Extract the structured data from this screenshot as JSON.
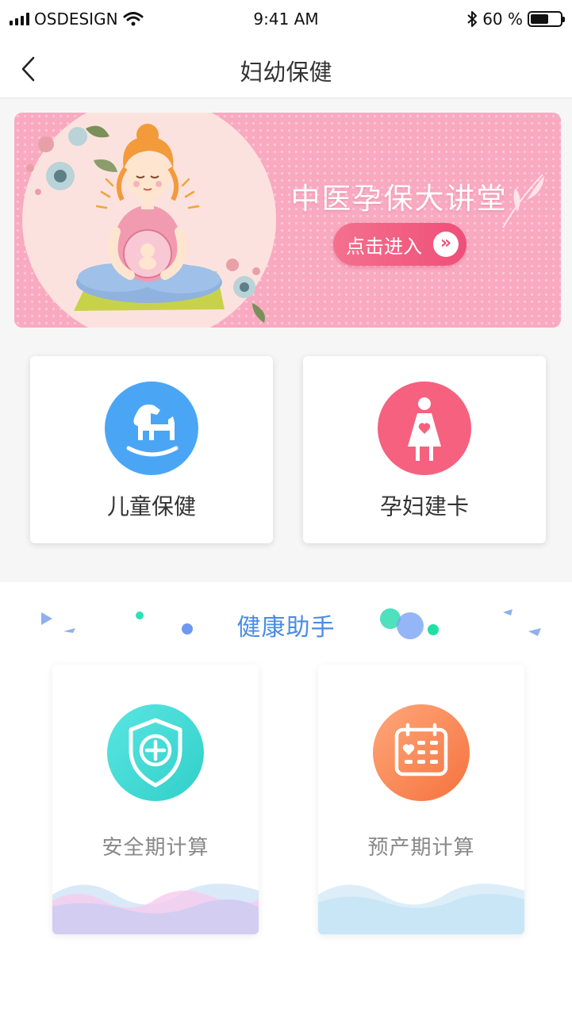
{
  "status_bar": {
    "carrier": "OSDESIGN",
    "time": "9:41 AM",
    "battery": "60 %",
    "battery_level": 0.6
  },
  "nav": {
    "title": "妇幼保健",
    "back_icon": "chevron-left-icon"
  },
  "banner": {
    "headline": "中医孕保大讲堂",
    "button_label": "点击进入",
    "button_icon": "double-chevron-right-icon",
    "colors": {
      "background": "#f9a9c0",
      "button": "#ef4f78"
    }
  },
  "services": [
    {
      "label": "儿童保健",
      "icon": "rocking-horse-icon",
      "color": "#4aa6f5"
    },
    {
      "label": "孕妇建卡",
      "icon": "pregnant-woman-icon",
      "color": "#f5617f"
    }
  ],
  "helper": {
    "title": "健康助手",
    "items": [
      {
        "label": "安全期计算",
        "icon": "shield-plus-icon",
        "color": "#3fd6d2"
      },
      {
        "label": "预产期计算",
        "icon": "calendar-heart-icon",
        "color": "#fa8457"
      }
    ]
  }
}
